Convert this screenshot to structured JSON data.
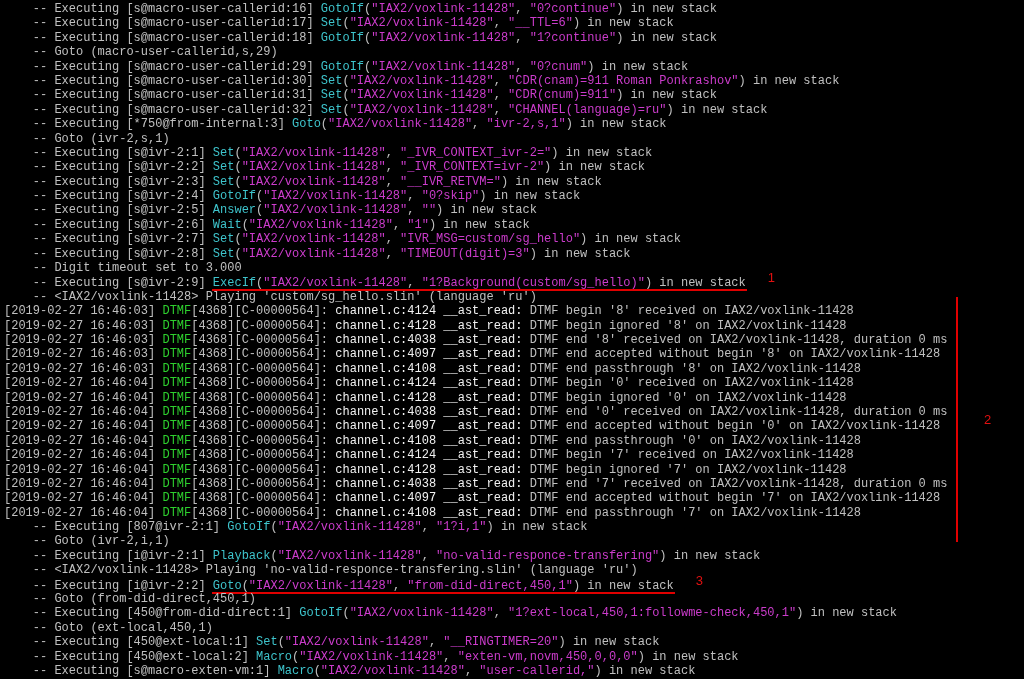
{
  "bracket": {
    "label": "2"
  },
  "lines": [
    {
      "kind": "verbose",
      "bracketed": false,
      "underlined": false,
      "parts": [
        {
          "kind": "plain",
          "text": "-- Executing [s@macro-user-callerid:16] "
        },
        {
          "kind": "app",
          "text": "GotoIf"
        },
        {
          "kind": "plain",
          "text": "("
        },
        {
          "kind": "arg",
          "text": "\"IAX2/voxlink-11428\""
        },
        {
          "kind": "plain",
          "text": ", "
        },
        {
          "kind": "arg",
          "text": "\"0?continue\""
        },
        {
          "kind": "plain",
          "text": ") in new stack"
        }
      ]
    },
    {
      "kind": "verbose",
      "bracketed": false,
      "underlined": false,
      "parts": [
        {
          "kind": "plain",
          "text": "-- Executing [s@macro-user-callerid:17] "
        },
        {
          "kind": "app",
          "text": "Set"
        },
        {
          "kind": "plain",
          "text": "("
        },
        {
          "kind": "arg",
          "text": "\"IAX2/voxlink-11428\""
        },
        {
          "kind": "plain",
          "text": ", "
        },
        {
          "kind": "arg",
          "text": "\"__TTL=6\""
        },
        {
          "kind": "plain",
          "text": ") in new stack"
        }
      ]
    },
    {
      "kind": "verbose",
      "bracketed": false,
      "underlined": false,
      "parts": [
        {
          "kind": "plain",
          "text": "-- Executing [s@macro-user-callerid:18] "
        },
        {
          "kind": "app",
          "text": "GotoIf"
        },
        {
          "kind": "plain",
          "text": "("
        },
        {
          "kind": "arg",
          "text": "\"IAX2/voxlink-11428\""
        },
        {
          "kind": "plain",
          "text": ", "
        },
        {
          "kind": "arg",
          "text": "\"1?continue\""
        },
        {
          "kind": "plain",
          "text": ") in new stack"
        }
      ]
    },
    {
      "kind": "verbose",
      "bracketed": false,
      "underlined": false,
      "parts": [
        {
          "kind": "plain",
          "text": "-- Goto (macro-user-callerid,s,29)"
        }
      ]
    },
    {
      "kind": "verbose",
      "bracketed": false,
      "underlined": false,
      "parts": [
        {
          "kind": "plain",
          "text": "-- Executing [s@macro-user-callerid:29] "
        },
        {
          "kind": "app",
          "text": "GotoIf"
        },
        {
          "kind": "plain",
          "text": "("
        },
        {
          "kind": "arg",
          "text": "\"IAX2/voxlink-11428\""
        },
        {
          "kind": "plain",
          "text": ", "
        },
        {
          "kind": "arg",
          "text": "\"0?cnum\""
        },
        {
          "kind": "plain",
          "text": ") in new stack"
        }
      ]
    },
    {
      "kind": "verbose",
      "bracketed": false,
      "underlined": false,
      "parts": [
        {
          "kind": "plain",
          "text": "-- Executing [s@macro-user-callerid:30] "
        },
        {
          "kind": "app",
          "text": "Set"
        },
        {
          "kind": "plain",
          "text": "("
        },
        {
          "kind": "arg",
          "text": "\"IAX2/voxlink-11428\""
        },
        {
          "kind": "plain",
          "text": ", "
        },
        {
          "kind": "arg",
          "text": "\"CDR(cnam)=911 Roman Ponkrashov\""
        },
        {
          "kind": "plain",
          "text": ") in new stack"
        }
      ]
    },
    {
      "kind": "verbose",
      "bracketed": false,
      "underlined": false,
      "parts": [
        {
          "kind": "plain",
          "text": "-- Executing [s@macro-user-callerid:31] "
        },
        {
          "kind": "app",
          "text": "Set"
        },
        {
          "kind": "plain",
          "text": "("
        },
        {
          "kind": "arg",
          "text": "\"IAX2/voxlink-11428\""
        },
        {
          "kind": "plain",
          "text": ", "
        },
        {
          "kind": "arg",
          "text": "\"CDR(cnum)=911\""
        },
        {
          "kind": "plain",
          "text": ") in new stack"
        }
      ]
    },
    {
      "kind": "verbose",
      "bracketed": false,
      "underlined": false,
      "parts": [
        {
          "kind": "plain",
          "text": "-- Executing [s@macro-user-callerid:32] "
        },
        {
          "kind": "app",
          "text": "Set"
        },
        {
          "kind": "plain",
          "text": "("
        },
        {
          "kind": "arg",
          "text": "\"IAX2/voxlink-11428\""
        },
        {
          "kind": "plain",
          "text": ", "
        },
        {
          "kind": "arg",
          "text": "\"CHANNEL(language)=ru\""
        },
        {
          "kind": "plain",
          "text": ") in new stack"
        }
      ]
    },
    {
      "kind": "verbose",
      "bracketed": false,
      "underlined": false,
      "parts": [
        {
          "kind": "plain",
          "text": "-- Executing [*750@from-internal:3] "
        },
        {
          "kind": "app",
          "text": "Goto"
        },
        {
          "kind": "plain",
          "text": "("
        },
        {
          "kind": "arg",
          "text": "\"IAX2/voxlink-11428\""
        },
        {
          "kind": "plain",
          "text": ", "
        },
        {
          "kind": "arg",
          "text": "\"ivr-2,s,1\""
        },
        {
          "kind": "plain",
          "text": ") in new stack"
        }
      ]
    },
    {
      "kind": "verbose",
      "bracketed": false,
      "underlined": false,
      "parts": [
        {
          "kind": "plain",
          "text": "-- Goto (ivr-2,s,1)"
        }
      ]
    },
    {
      "kind": "verbose",
      "bracketed": false,
      "underlined": false,
      "parts": [
        {
          "kind": "plain",
          "text": "-- Executing [s@ivr-2:1] "
        },
        {
          "kind": "app",
          "text": "Set"
        },
        {
          "kind": "plain",
          "text": "("
        },
        {
          "kind": "arg",
          "text": "\"IAX2/voxlink-11428\""
        },
        {
          "kind": "plain",
          "text": ", "
        },
        {
          "kind": "arg",
          "text": "\"_IVR_CONTEXT_ivr-2=\""
        },
        {
          "kind": "plain",
          "text": ") in new stack"
        }
      ]
    },
    {
      "kind": "verbose",
      "bracketed": false,
      "underlined": false,
      "parts": [
        {
          "kind": "plain",
          "text": "-- Executing [s@ivr-2:2] "
        },
        {
          "kind": "app",
          "text": "Set"
        },
        {
          "kind": "plain",
          "text": "("
        },
        {
          "kind": "arg",
          "text": "\"IAX2/voxlink-11428\""
        },
        {
          "kind": "plain",
          "text": ", "
        },
        {
          "kind": "arg",
          "text": "\"_IVR_CONTEXT=ivr-2\""
        },
        {
          "kind": "plain",
          "text": ") in new stack"
        }
      ]
    },
    {
      "kind": "verbose",
      "bracketed": false,
      "underlined": false,
      "parts": [
        {
          "kind": "plain",
          "text": "-- Executing [s@ivr-2:3] "
        },
        {
          "kind": "app",
          "text": "Set"
        },
        {
          "kind": "plain",
          "text": "("
        },
        {
          "kind": "arg",
          "text": "\"IAX2/voxlink-11428\""
        },
        {
          "kind": "plain",
          "text": ", "
        },
        {
          "kind": "arg",
          "text": "\"__IVR_RETVM=\""
        },
        {
          "kind": "plain",
          "text": ") in new stack"
        }
      ]
    },
    {
      "kind": "verbose",
      "bracketed": false,
      "underlined": false,
      "parts": [
        {
          "kind": "plain",
          "text": "-- Executing [s@ivr-2:4] "
        },
        {
          "kind": "app",
          "text": "GotoIf"
        },
        {
          "kind": "plain",
          "text": "("
        },
        {
          "kind": "arg",
          "text": "\"IAX2/voxlink-11428\""
        },
        {
          "kind": "plain",
          "text": ", "
        },
        {
          "kind": "arg",
          "text": "\"0?skip\""
        },
        {
          "kind": "plain",
          "text": ") in new stack"
        }
      ]
    },
    {
      "kind": "verbose",
      "bracketed": false,
      "underlined": false,
      "parts": [
        {
          "kind": "plain",
          "text": "-- Executing [s@ivr-2:5] "
        },
        {
          "kind": "app",
          "text": "Answer"
        },
        {
          "kind": "plain",
          "text": "("
        },
        {
          "kind": "arg",
          "text": "\"IAX2/voxlink-11428\""
        },
        {
          "kind": "plain",
          "text": ", "
        },
        {
          "kind": "arg",
          "text": "\"\""
        },
        {
          "kind": "plain",
          "text": ") in new stack"
        }
      ]
    },
    {
      "kind": "verbose",
      "bracketed": false,
      "underlined": false,
      "parts": [
        {
          "kind": "plain",
          "text": "-- Executing [s@ivr-2:6] "
        },
        {
          "kind": "app",
          "text": "Wait"
        },
        {
          "kind": "plain",
          "text": "("
        },
        {
          "kind": "arg",
          "text": "\"IAX2/voxlink-11428\""
        },
        {
          "kind": "plain",
          "text": ", "
        },
        {
          "kind": "arg",
          "text": "\"1\""
        },
        {
          "kind": "plain",
          "text": ") in new stack"
        }
      ]
    },
    {
      "kind": "verbose",
      "bracketed": false,
      "underlined": false,
      "parts": [
        {
          "kind": "plain",
          "text": "-- Executing [s@ivr-2:7] "
        },
        {
          "kind": "app",
          "text": "Set"
        },
        {
          "kind": "plain",
          "text": "("
        },
        {
          "kind": "arg",
          "text": "\"IAX2/voxlink-11428\""
        },
        {
          "kind": "plain",
          "text": ", "
        },
        {
          "kind": "arg",
          "text": "\"IVR_MSG=custom/sg_hello\""
        },
        {
          "kind": "plain",
          "text": ") in new stack"
        }
      ]
    },
    {
      "kind": "verbose",
      "bracketed": false,
      "underlined": false,
      "parts": [
        {
          "kind": "plain",
          "text": "-- Executing [s@ivr-2:8] "
        },
        {
          "kind": "app",
          "text": "Set"
        },
        {
          "kind": "plain",
          "text": "("
        },
        {
          "kind": "arg",
          "text": "\"IAX2/voxlink-11428\""
        },
        {
          "kind": "plain",
          "text": ", "
        },
        {
          "kind": "arg",
          "text": "\"TIMEOUT(digit)=3\""
        },
        {
          "kind": "plain",
          "text": ") in new stack"
        }
      ]
    },
    {
      "kind": "verbose",
      "bracketed": false,
      "underlined": false,
      "parts": [
        {
          "kind": "plain",
          "text": "-- Digit timeout set to 3.000"
        }
      ]
    },
    {
      "kind": "verbose",
      "bracketed": false,
      "underlined": true,
      "marker": "1",
      "parts": [
        {
          "kind": "plain",
          "text": "-- Executing [s@ivr-2:9] "
        },
        {
          "kind": "app",
          "text": "ExecIf"
        },
        {
          "kind": "plain",
          "text": "("
        },
        {
          "kind": "arg",
          "text": "\"IAX2/voxlink-11428\""
        },
        {
          "kind": "plain",
          "text": ", "
        },
        {
          "kind": "arg",
          "text": "\"1?Background(custom/sg_hello)\""
        },
        {
          "kind": "plain",
          "text": ") in new stack"
        }
      ]
    },
    {
      "kind": "verbose",
      "bracketed": true,
      "underlined": false,
      "parts": [
        {
          "kind": "plain",
          "text": "-- <IAX2/voxlink-11428> Playing 'custom/sg_hello.slin' (language 'ru')"
        }
      ]
    },
    {
      "kind": "log",
      "bracketed": true,
      "underlined": false,
      "parts": [
        {
          "kind": "plain",
          "text": "[2019-02-27 16:46:03] "
        },
        {
          "kind": "tag",
          "text": "DTMF"
        },
        {
          "kind": "plain",
          "text": "[4368][C-00000564]: "
        },
        {
          "kind": "source",
          "text": "channel.c:4124 __ast_read:"
        },
        {
          "kind": "plain",
          "text": " DTMF begin '8' received on IAX2/voxlink-11428"
        }
      ]
    },
    {
      "kind": "log",
      "bracketed": true,
      "underlined": false,
      "parts": [
        {
          "kind": "plain",
          "text": "[2019-02-27 16:46:03] "
        },
        {
          "kind": "tag",
          "text": "DTMF"
        },
        {
          "kind": "plain",
          "text": "[4368][C-00000564]: "
        },
        {
          "kind": "source",
          "text": "channel.c:4128 __ast_read:"
        },
        {
          "kind": "plain",
          "text": " DTMF begin ignored '8' on IAX2/voxlink-11428"
        }
      ]
    },
    {
      "kind": "log",
      "bracketed": true,
      "underlined": false,
      "parts": [
        {
          "kind": "plain",
          "text": "[2019-02-27 16:46:03] "
        },
        {
          "kind": "tag",
          "text": "DTMF"
        },
        {
          "kind": "plain",
          "text": "[4368][C-00000564]: "
        },
        {
          "kind": "source",
          "text": "channel.c:4038 __ast_read:"
        },
        {
          "kind": "plain",
          "text": " DTMF end '8' received on IAX2/voxlink-11428, duration 0 ms"
        }
      ]
    },
    {
      "kind": "log",
      "bracketed": true,
      "underlined": false,
      "parts": [
        {
          "kind": "plain",
          "text": "[2019-02-27 16:46:03] "
        },
        {
          "kind": "tag",
          "text": "DTMF"
        },
        {
          "kind": "plain",
          "text": "[4368][C-00000564]: "
        },
        {
          "kind": "source",
          "text": "channel.c:4097 __ast_read:"
        },
        {
          "kind": "plain",
          "text": " DTMF end accepted without begin '8' on IAX2/voxlink-11428"
        }
      ]
    },
    {
      "kind": "log",
      "bracketed": true,
      "underlined": false,
      "parts": [
        {
          "kind": "plain",
          "text": "[2019-02-27 16:46:03] "
        },
        {
          "kind": "tag",
          "text": "DTMF"
        },
        {
          "kind": "plain",
          "text": "[4368][C-00000564]: "
        },
        {
          "kind": "source",
          "text": "channel.c:4108 __ast_read:"
        },
        {
          "kind": "plain",
          "text": " DTMF end passthrough '8' on IAX2/voxlink-11428"
        }
      ]
    },
    {
      "kind": "log",
      "bracketed": true,
      "underlined": false,
      "parts": [
        {
          "kind": "plain",
          "text": "[2019-02-27 16:46:04] "
        },
        {
          "kind": "tag",
          "text": "DTMF"
        },
        {
          "kind": "plain",
          "text": "[4368][C-00000564]: "
        },
        {
          "kind": "source",
          "text": "channel.c:4124 __ast_read:"
        },
        {
          "kind": "plain",
          "text": " DTMF begin '0' received on IAX2/voxlink-11428"
        }
      ]
    },
    {
      "kind": "log",
      "bracketed": true,
      "underlined": false,
      "parts": [
        {
          "kind": "plain",
          "text": "[2019-02-27 16:46:04] "
        },
        {
          "kind": "tag",
          "text": "DTMF"
        },
        {
          "kind": "plain",
          "text": "[4368][C-00000564]: "
        },
        {
          "kind": "source",
          "text": "channel.c:4128 __ast_read:"
        },
        {
          "kind": "plain",
          "text": " DTMF begin ignored '0' on IAX2/voxlink-11428"
        }
      ]
    },
    {
      "kind": "log",
      "bracketed": true,
      "underlined": false,
      "parts": [
        {
          "kind": "plain",
          "text": "[2019-02-27 16:46:04] "
        },
        {
          "kind": "tag",
          "text": "DTMF"
        },
        {
          "kind": "plain",
          "text": "[4368][C-00000564]: "
        },
        {
          "kind": "source",
          "text": "channel.c:4038 __ast_read:"
        },
        {
          "kind": "plain",
          "text": " DTMF end '0' received on IAX2/voxlink-11428, duration 0 ms"
        }
      ]
    },
    {
      "kind": "log",
      "bracketed": true,
      "underlined": false,
      "parts": [
        {
          "kind": "plain",
          "text": "[2019-02-27 16:46:04] "
        },
        {
          "kind": "tag",
          "text": "DTMF"
        },
        {
          "kind": "plain",
          "text": "[4368][C-00000564]: "
        },
        {
          "kind": "source",
          "text": "channel.c:4097 __ast_read:"
        },
        {
          "kind": "plain",
          "text": " DTMF end accepted without begin '0' on IAX2/voxlink-11428"
        }
      ]
    },
    {
      "kind": "log",
      "bracketed": true,
      "underlined": false,
      "parts": [
        {
          "kind": "plain",
          "text": "[2019-02-27 16:46:04] "
        },
        {
          "kind": "tag",
          "text": "DTMF"
        },
        {
          "kind": "plain",
          "text": "[4368][C-00000564]: "
        },
        {
          "kind": "source",
          "text": "channel.c:4108 __ast_read:"
        },
        {
          "kind": "plain",
          "text": " DTMF end passthrough '0' on IAX2/voxlink-11428"
        }
      ]
    },
    {
      "kind": "log",
      "bracketed": true,
      "underlined": false,
      "parts": [
        {
          "kind": "plain",
          "text": "[2019-02-27 16:46:04] "
        },
        {
          "kind": "tag",
          "text": "DTMF"
        },
        {
          "kind": "plain",
          "text": "[4368][C-00000564]: "
        },
        {
          "kind": "source",
          "text": "channel.c:4124 __ast_read:"
        },
        {
          "kind": "plain",
          "text": " DTMF begin '7' received on IAX2/voxlink-11428"
        }
      ]
    },
    {
      "kind": "log",
      "bracketed": true,
      "underlined": false,
      "parts": [
        {
          "kind": "plain",
          "text": "[2019-02-27 16:46:04] "
        },
        {
          "kind": "tag",
          "text": "DTMF"
        },
        {
          "kind": "plain",
          "text": "[4368][C-00000564]: "
        },
        {
          "kind": "source",
          "text": "channel.c:4128 __ast_read:"
        },
        {
          "kind": "plain",
          "text": " DTMF begin ignored '7' on IAX2/voxlink-11428"
        }
      ]
    },
    {
      "kind": "log",
      "bracketed": true,
      "underlined": false,
      "parts": [
        {
          "kind": "plain",
          "text": "[2019-02-27 16:46:04] "
        },
        {
          "kind": "tag",
          "text": "DTMF"
        },
        {
          "kind": "plain",
          "text": "[4368][C-00000564]: "
        },
        {
          "kind": "source",
          "text": "channel.c:4038 __ast_read:"
        },
        {
          "kind": "plain",
          "text": " DTMF end '7' received on IAX2/voxlink-11428, duration 0 ms"
        }
      ]
    },
    {
      "kind": "log",
      "bracketed": true,
      "underlined": false,
      "parts": [
        {
          "kind": "plain",
          "text": "[2019-02-27 16:46:04] "
        },
        {
          "kind": "tag",
          "text": "DTMF"
        },
        {
          "kind": "plain",
          "text": "[4368][C-00000564]: "
        },
        {
          "kind": "source",
          "text": "channel.c:4097 __ast_read:"
        },
        {
          "kind": "plain",
          "text": " DTMF end accepted without begin '7' on IAX2/voxlink-11428"
        }
      ]
    },
    {
      "kind": "log",
      "bracketed": true,
      "underlined": false,
      "parts": [
        {
          "kind": "plain",
          "text": "[2019-02-27 16:46:04] "
        },
        {
          "kind": "tag",
          "text": "DTMF"
        },
        {
          "kind": "plain",
          "text": "[4368][C-00000564]: "
        },
        {
          "kind": "source",
          "text": "channel.c:4108 __ast_read:"
        },
        {
          "kind": "plain",
          "text": " DTMF end passthrough '7' on IAX2/voxlink-11428"
        }
      ]
    },
    {
      "kind": "verbose",
      "bracketed": true,
      "underlined": false,
      "parts": [
        {
          "kind": "plain",
          "text": "-- Executing [807@ivr-2:1] "
        },
        {
          "kind": "app",
          "text": "GotoIf"
        },
        {
          "kind": "plain",
          "text": "("
        },
        {
          "kind": "arg",
          "text": "\"IAX2/voxlink-11428\""
        },
        {
          "kind": "plain",
          "text": ", "
        },
        {
          "kind": "arg",
          "text": "\"1?i,1\""
        },
        {
          "kind": "plain",
          "text": ") in new stack"
        }
      ]
    },
    {
      "kind": "verbose",
      "bracketed": true,
      "underlined": false,
      "parts": [
        {
          "kind": "plain",
          "text": "-- Goto (ivr-2,i,1)"
        }
      ]
    },
    {
      "kind": "verbose",
      "bracketed": false,
      "underlined": false,
      "parts": [
        {
          "kind": "plain",
          "text": "-- Executing [i@ivr-2:1] "
        },
        {
          "kind": "app",
          "text": "Playback"
        },
        {
          "kind": "plain",
          "text": "("
        },
        {
          "kind": "arg",
          "text": "\"IAX2/voxlink-11428\""
        },
        {
          "kind": "plain",
          "text": ", "
        },
        {
          "kind": "arg",
          "text": "\"no-valid-responce-transfering\""
        },
        {
          "kind": "plain",
          "text": ") in new stack"
        }
      ]
    },
    {
      "kind": "verbose",
      "bracketed": false,
      "underlined": false,
      "parts": [
        {
          "kind": "plain",
          "text": "-- <IAX2/voxlink-11428> Playing 'no-valid-responce-transfering.slin' (language 'ru')"
        }
      ]
    },
    {
      "kind": "verbose",
      "bracketed": false,
      "underlined": true,
      "marker": "3",
      "parts": [
        {
          "kind": "plain",
          "text": "-- Executing [i@ivr-2:2] "
        },
        {
          "kind": "app",
          "text": "Goto"
        },
        {
          "kind": "plain",
          "text": "("
        },
        {
          "kind": "arg",
          "text": "\"IAX2/voxlink-11428\""
        },
        {
          "kind": "plain",
          "text": ", "
        },
        {
          "kind": "arg",
          "text": "\"from-did-direct,450,1\""
        },
        {
          "kind": "plain",
          "text": ") in new stack"
        }
      ]
    },
    {
      "kind": "verbose",
      "bracketed": false,
      "underlined": false,
      "parts": [
        {
          "kind": "plain",
          "text": "-- Goto (from-did-direct,450,1)"
        }
      ]
    },
    {
      "kind": "verbose",
      "bracketed": false,
      "underlined": false,
      "parts": [
        {
          "kind": "plain",
          "text": "-- Executing [450@from-did-direct:1] "
        },
        {
          "kind": "app",
          "text": "GotoIf"
        },
        {
          "kind": "plain",
          "text": "("
        },
        {
          "kind": "arg",
          "text": "\"IAX2/voxlink-11428\""
        },
        {
          "kind": "plain",
          "text": ", "
        },
        {
          "kind": "arg",
          "text": "\"1?ext-local,450,1:followme-check,450,1\""
        },
        {
          "kind": "plain",
          "text": ") in new stack"
        }
      ]
    },
    {
      "kind": "verbose",
      "bracketed": false,
      "underlined": false,
      "parts": [
        {
          "kind": "plain",
          "text": "-- Goto (ext-local,450,1)"
        }
      ]
    },
    {
      "kind": "verbose",
      "bracketed": false,
      "underlined": false,
      "parts": [
        {
          "kind": "plain",
          "text": "-- Executing [450@ext-local:1] "
        },
        {
          "kind": "app",
          "text": "Set"
        },
        {
          "kind": "plain",
          "text": "("
        },
        {
          "kind": "arg",
          "text": "\"IAX2/voxlink-11428\""
        },
        {
          "kind": "plain",
          "text": ", "
        },
        {
          "kind": "arg",
          "text": "\"__RINGTIMER=20\""
        },
        {
          "kind": "plain",
          "text": ") in new stack"
        }
      ]
    },
    {
      "kind": "verbose",
      "bracketed": false,
      "underlined": false,
      "parts": [
        {
          "kind": "plain",
          "text": "-- Executing [450@ext-local:2] "
        },
        {
          "kind": "app",
          "text": "Macro"
        },
        {
          "kind": "plain",
          "text": "("
        },
        {
          "kind": "arg",
          "text": "\"IAX2/voxlink-11428\""
        },
        {
          "kind": "plain",
          "text": ", "
        },
        {
          "kind": "arg",
          "text": "\"exten-vm,novm,450,0,0,0\""
        },
        {
          "kind": "plain",
          "text": ") in new stack"
        }
      ]
    },
    {
      "kind": "verbose",
      "bracketed": false,
      "underlined": false,
      "parts": [
        {
          "kind": "plain",
          "text": "-- Executing [s@macro-exten-vm:1] "
        },
        {
          "kind": "app",
          "text": "Macro"
        },
        {
          "kind": "plain",
          "text": "("
        },
        {
          "kind": "arg",
          "text": "\"IAX2/voxlink-11428\""
        },
        {
          "kind": "plain",
          "text": ", "
        },
        {
          "kind": "arg",
          "text": "\"user-callerid,\""
        },
        {
          "kind": "plain",
          "text": ") in new stack"
        }
      ]
    }
  ]
}
